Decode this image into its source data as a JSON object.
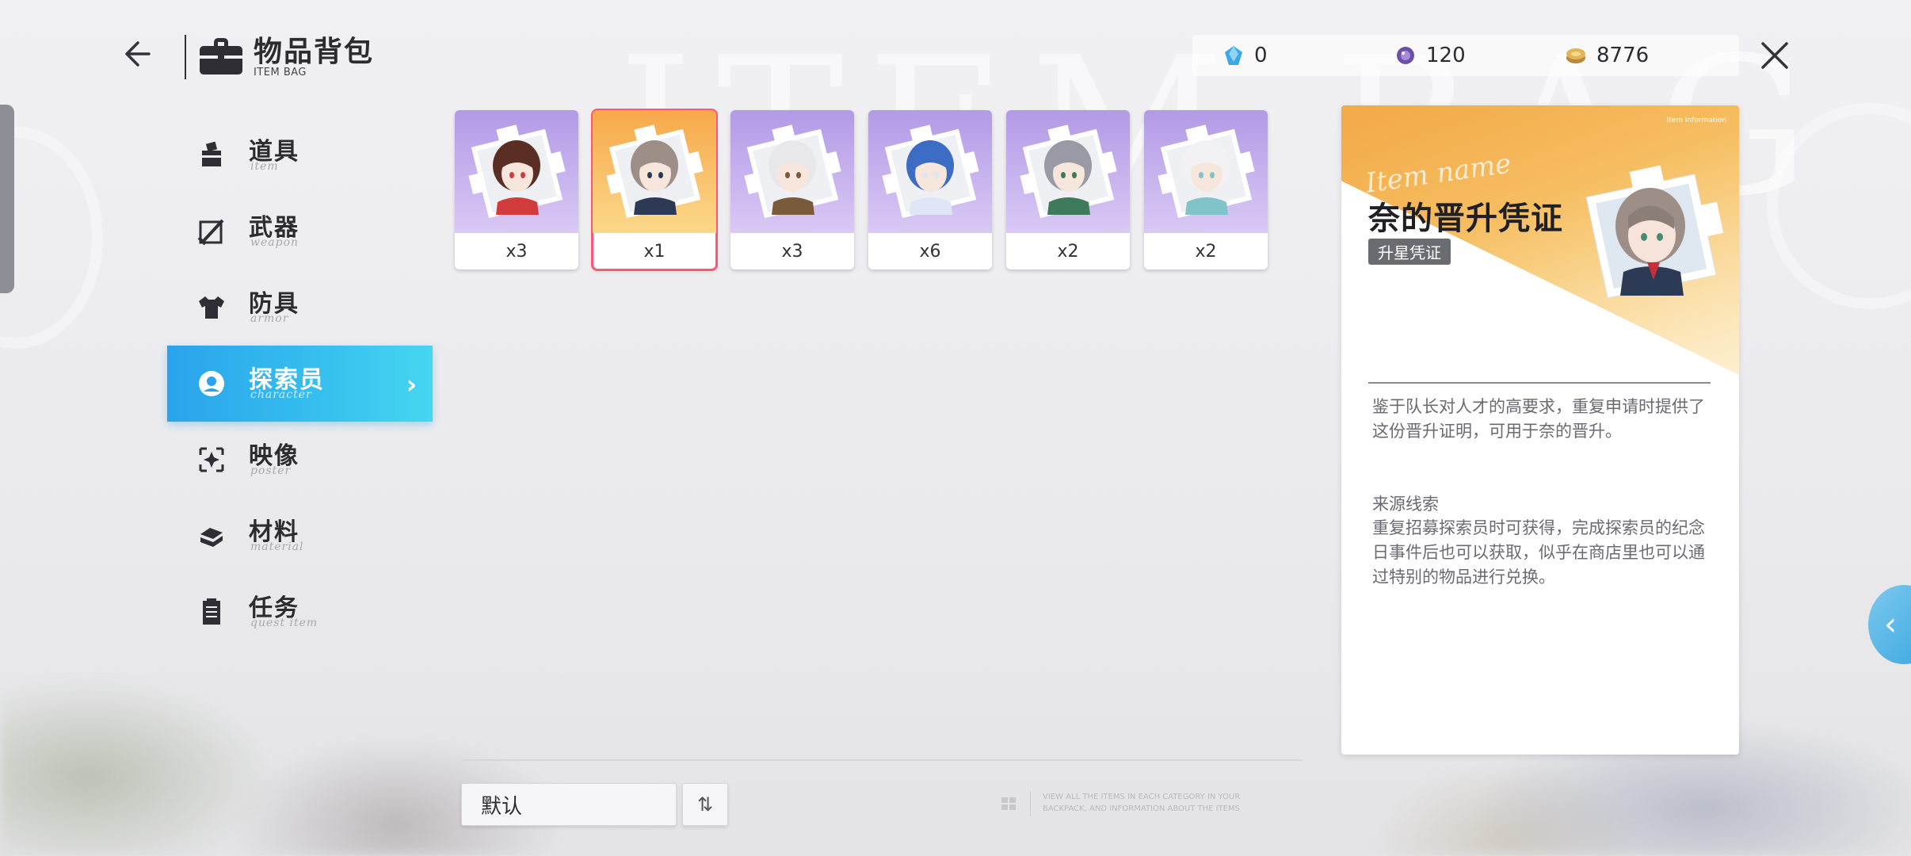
{
  "header": {
    "title": "物品背包",
    "subtitle": "ITEM BAG",
    "background_word": "ITEM BAG"
  },
  "currencies": [
    {
      "icon": "blue-crystal-icon",
      "value": "0"
    },
    {
      "icon": "purple-orb-icon",
      "value": "120"
    },
    {
      "icon": "gold-coin-icon",
      "value": "8776"
    }
  ],
  "sidebar": {
    "items": [
      {
        "label": "道具",
        "sub": "item",
        "icon": "item-box-icon"
      },
      {
        "label": "武器",
        "sub": "weapon",
        "icon": "weapon-icon"
      },
      {
        "label": "防具",
        "sub": "armor",
        "icon": "armor-icon"
      },
      {
        "label": "探索员",
        "sub": "character",
        "icon": "character-icon",
        "active": true
      },
      {
        "label": "映像",
        "sub": "poster",
        "icon": "poster-icon"
      },
      {
        "label": "材料",
        "sub": "material",
        "icon": "material-icon"
      },
      {
        "label": "任务",
        "sub": "quest item",
        "icon": "quest-icon"
      }
    ]
  },
  "items": [
    {
      "qty": "x3",
      "hair": "#5a2e24",
      "accent": "#d23b3b"
    },
    {
      "qty": "x1",
      "hair": "#9d8f88",
      "accent": "#2d3a56",
      "selected": true
    },
    {
      "qty": "x3",
      "hair": "#e8e8ea",
      "accent": "#7a5a3a"
    },
    {
      "qty": "x6",
      "hair": "#3c6cc4",
      "accent": "#dfe6f5"
    },
    {
      "qty": "x2",
      "hair": "#9a9aa6",
      "accent": "#3c7a5a"
    },
    {
      "qty": "x2",
      "hair": "#f2f2f4",
      "accent": "#7fc4c8"
    }
  ],
  "bottom": {
    "sort_label": "默认",
    "sort_toggle": "⇅",
    "hint": "VIEW ALL THE ITEMS IN EACH CATEGORY IN YOUR BACKPACK, AND INFORMATION ABOUT THE ITEMS"
  },
  "info": {
    "tag": "Item Information",
    "script": "Item name",
    "name": "奈的晋升凭证",
    "badge": "升星凭证",
    "description": "鉴于队长对人才的高要求，重复申请时提供了这份晋升证明，可用于奈的晋升。",
    "source_title": "来源线索",
    "source": "重复招募探索员时可获得，完成探索员的纪念日事件后也可以获取，似乎在商店里也可以通过特别的物品进行兑换。"
  },
  "colors": {
    "accent_blue": "#2aa3ec",
    "selected_border": "#ff5577",
    "card_purple": "#b39ae6",
    "card_gold": "#f7a84a"
  }
}
